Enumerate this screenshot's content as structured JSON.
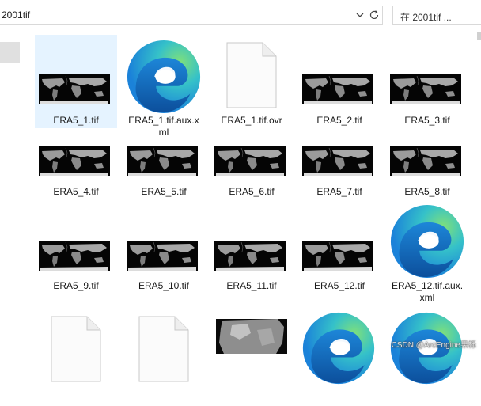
{
  "address_bar": {
    "path": "2001tif",
    "dropdown_icon": "chevron-down-icon",
    "refresh_icon": "refresh-icon"
  },
  "search": {
    "placeholder": "在 2001tif ..."
  },
  "files": [
    {
      "name": "ERA5_1.tif",
      "kind": "raster",
      "selected": true
    },
    {
      "name": "ERA5_1.tif.aux.x\nml",
      "kind": "edge"
    },
    {
      "name": "ERA5_1.tif.ovr",
      "kind": "blank"
    },
    {
      "name": "ERA5_2.tif",
      "kind": "raster"
    },
    {
      "name": "ERA5_3.tif",
      "kind": "raster"
    },
    {
      "name": "ERA5_4.tif",
      "kind": "raster"
    },
    {
      "name": "ERA5_5.tif",
      "kind": "raster"
    },
    {
      "name": "ERA5_6.tif",
      "kind": "raster"
    },
    {
      "name": "ERA5_7.tif",
      "kind": "raster"
    },
    {
      "name": "ERA5_8.tif",
      "kind": "raster"
    },
    {
      "name": "ERA5_9.tif",
      "kind": "raster"
    },
    {
      "name": "ERA5_10.tif",
      "kind": "raster"
    },
    {
      "name": "ERA5_11.tif",
      "kind": "raster"
    },
    {
      "name": "ERA5_12.tif",
      "kind": "raster"
    },
    {
      "name": "ERA5_12.tif.aux.\nxml",
      "kind": "edge"
    },
    {
      "name": "",
      "kind": "blank"
    },
    {
      "name": "",
      "kind": "blank"
    },
    {
      "name": "",
      "kind": "raster-large"
    },
    {
      "name": "",
      "kind": "edge"
    },
    {
      "name": "",
      "kind": "edge"
    }
  ],
  "watermark": "CSDN @ArcEngine果栎",
  "colors": {
    "selection": "#e5f3ff",
    "edge_blue": "#1d7fd6",
    "edge_green": "#5ccf6a"
  }
}
